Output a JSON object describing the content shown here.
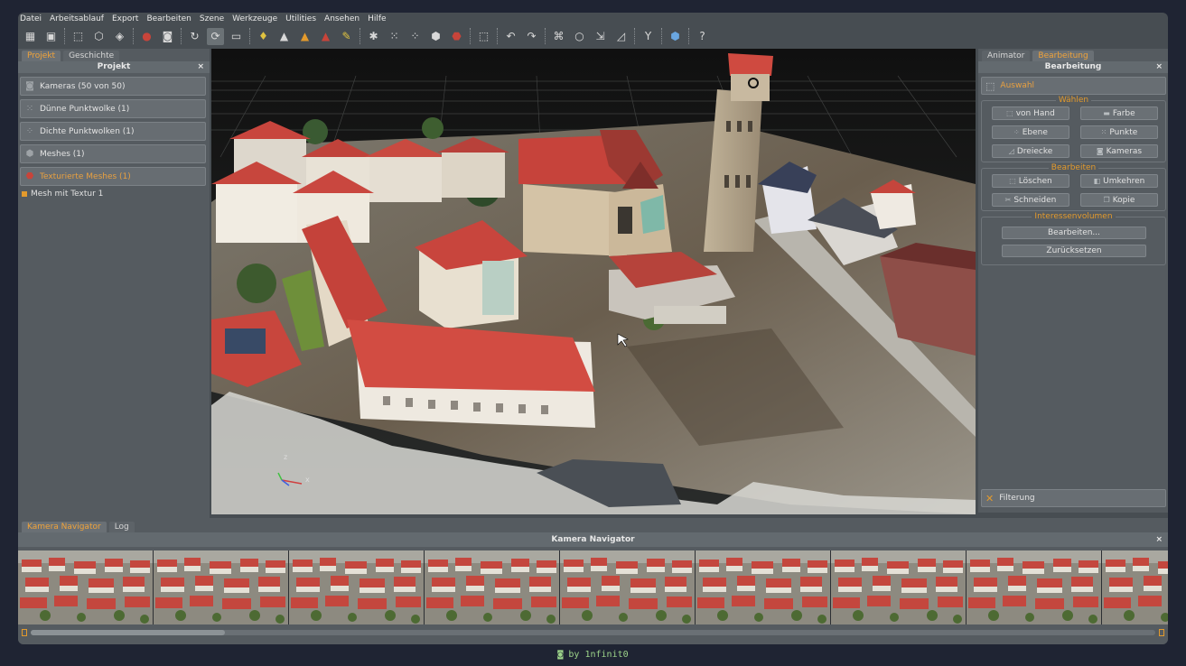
{
  "menu": [
    "Datei",
    "Arbeitsablauf",
    "Export",
    "Bearbeiten",
    "Szene",
    "Werkzeuge",
    "Utilities",
    "Ansehen",
    "Hilfe"
  ],
  "toolbar": {
    "buttons": [
      {
        "name": "new-project-icon",
        "glyph": "▦"
      },
      {
        "name": "save-icon",
        "glyph": "▣"
      },
      {
        "sep": true
      },
      {
        "name": "select-frame-icon",
        "glyph": "⬚"
      },
      {
        "name": "grid-cube-icon",
        "glyph": "⬡"
      },
      {
        "name": "cube-icon",
        "glyph": "◈"
      },
      {
        "sep": true
      },
      {
        "name": "red-marker-icon",
        "glyph": "●",
        "color": "#c8443a"
      },
      {
        "name": "camera-icon",
        "glyph": "◙"
      },
      {
        "sep": true
      },
      {
        "name": "rotate-icon",
        "glyph": "↻"
      },
      {
        "name": "orbit-icon",
        "glyph": "⟳",
        "active": true
      },
      {
        "name": "bbox-icon",
        "glyph": "▭"
      },
      {
        "sep": true
      },
      {
        "name": "light-icon",
        "glyph": "♦",
        "color": "#e0c340"
      },
      {
        "name": "points-icon",
        "glyph": "▲"
      },
      {
        "name": "mesh-icon",
        "glyph": "▲",
        "color": "#e39a2c"
      },
      {
        "name": "texture-icon",
        "glyph": "▲",
        "color": "#c8443a"
      },
      {
        "name": "brush-icon",
        "glyph": "✎",
        "color": "#e0c340"
      },
      {
        "sep": true
      },
      {
        "name": "tool-a-icon",
        "glyph": "✱"
      },
      {
        "name": "scatter-icon",
        "glyph": "⁙"
      },
      {
        "name": "dense-icon",
        "glyph": "⁘"
      },
      {
        "name": "wire-icon",
        "glyph": "⬢"
      },
      {
        "name": "color-mesh-icon",
        "glyph": "⬣",
        "color": "#c8443a"
      },
      {
        "sep": true
      },
      {
        "name": "crop-icon",
        "glyph": "⬚"
      },
      {
        "sep": true
      },
      {
        "name": "undo-icon",
        "glyph": "↶"
      },
      {
        "name": "redo-icon",
        "glyph": "↷"
      },
      {
        "sep": true
      },
      {
        "name": "lasso-icon",
        "glyph": "⌘"
      },
      {
        "name": "circle-select-icon",
        "glyph": "○"
      },
      {
        "name": "pointer-icon",
        "glyph": "⇲"
      },
      {
        "name": "ruler-icon",
        "glyph": "◿"
      },
      {
        "sep": true
      },
      {
        "name": "split-icon",
        "glyph": "Y"
      },
      {
        "sep": true
      },
      {
        "name": "view-cube-icon",
        "glyph": "⬢",
        "color": "#6aa6e0"
      },
      {
        "sep": true
      },
      {
        "name": "help-icon",
        "glyph": "?"
      }
    ]
  },
  "left": {
    "tabs": [
      "Projekt",
      "Geschichte"
    ],
    "title": "Projekt",
    "rows": [
      {
        "icon": "camera-icon",
        "glyph": "◙",
        "label": "Kameras (50  von  50)"
      },
      {
        "icon": "sparse-cloud-icon",
        "glyph": "⁙",
        "label": "Dünne Punktwolke (1)"
      },
      {
        "icon": "dense-cloud-icon",
        "glyph": "⁘",
        "label": "Dichte Punktwolken (1)"
      },
      {
        "icon": "mesh-icon",
        "glyph": "⬢",
        "label": "Meshes (1)"
      },
      {
        "icon": "textured-mesh-icon",
        "glyph": "⬣",
        "label": "Texturierte Meshes (1)",
        "highlight": true
      }
    ],
    "tree_item": "Mesh mit Textur 1"
  },
  "right": {
    "tabs": [
      "Animator",
      "Bearbeitung"
    ],
    "title": "Bearbeitung",
    "selection_label": "Auswahl",
    "select_group": {
      "title": "Wählen",
      "buttons": [
        {
          "label": "von Hand",
          "glyph": "⬚"
        },
        {
          "label": "Farbe",
          "glyph": "▬"
        },
        {
          "label": "Ebene",
          "glyph": "⁘"
        },
        {
          "label": "Punkte",
          "glyph": "⁙"
        },
        {
          "label": "Dreiecke",
          "glyph": "◿"
        },
        {
          "label": "Kameras",
          "glyph": "◙"
        }
      ]
    },
    "edit_group": {
      "title": "Bearbeiten",
      "buttons": [
        {
          "label": "Löschen",
          "glyph": "⬚"
        },
        {
          "label": "Umkehren",
          "glyph": "◧"
        },
        {
          "label": "Schneiden",
          "glyph": "✂"
        },
        {
          "label": "Kopie",
          "glyph": "❐"
        }
      ]
    },
    "volume_group": {
      "title": "Interessenvolumen",
      "buttons": [
        "Bearbeiten...",
        "Zurücksetzen"
      ]
    },
    "filter_label": "Filterung"
  },
  "bottom": {
    "tabs": [
      "Kamera Navigator",
      "Log"
    ],
    "title": "Kamera Navigator"
  },
  "axis": {
    "z": "z",
    "x": "x"
  },
  "credit": "by 1nfinit0"
}
